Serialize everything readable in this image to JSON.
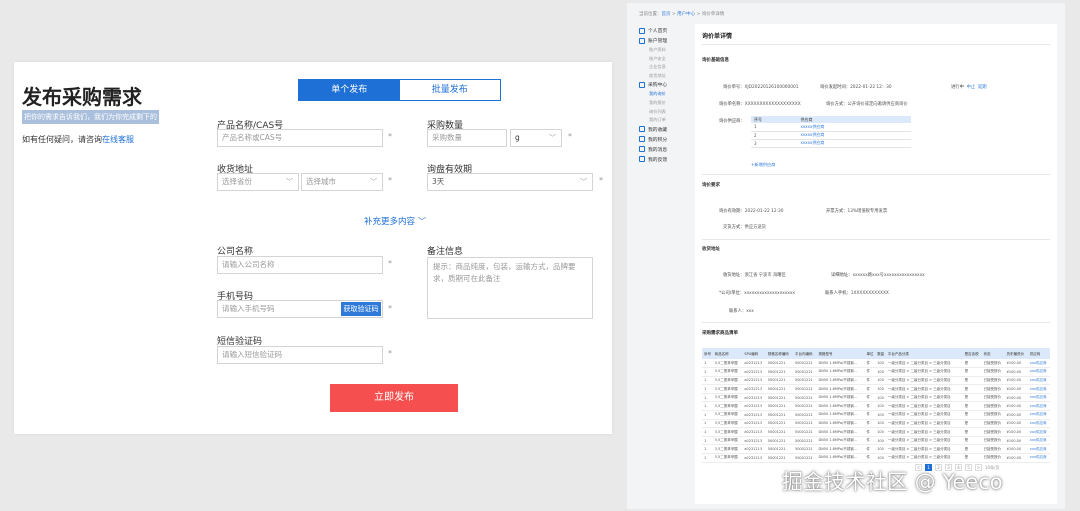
{
  "publish": {
    "title": "发布采购需求",
    "highlight": "把你的需求告诉我们，我们为你完成剩下的",
    "contact_text": "如有任何疑问，请咨询",
    "contact_link": "在线客服",
    "tabs": [
      "单个发布",
      "批量发布"
    ],
    "active_tab": "单个发布",
    "fields": {
      "product_label": "产品名称/CAS号",
      "product_placeholder": "产品名称或CAS号",
      "qty_label": "采购数量",
      "qty_placeholder": "采购数量",
      "unit_value": "g",
      "address_label": "收货地址",
      "province_placeholder": "选择省份",
      "city_placeholder": "选择城市",
      "validity_label": "询盘有效期",
      "validity_value": "3天",
      "more_link": "补充更多内容",
      "company_label": "公司名称",
      "company_placeholder": "请输入公司名称",
      "remark_label": "备注信息",
      "remark_placeholder": "提示：商品纯度，包装，运输方式，品牌要求，质期可在此备注",
      "phone_label": "手机号码",
      "phone_placeholder": "请输入手机号码",
      "get_code_button": "获取验证码",
      "code_label": "短信验证码",
      "code_placeholder": "请输入短信验证码",
      "required_mark": "*"
    },
    "submit": "立即发布"
  },
  "detail": {
    "breadcrumb": {
      "prefix": "当前位置：",
      "home": "首页",
      "sep": ">",
      "center": "用户中心",
      "current": "询价单详情"
    },
    "sidebar": [
      {
        "label": "个人首页",
        "icon": "home-icon",
        "subs": []
      },
      {
        "label": "账户管理",
        "icon": "account-icon",
        "subs": [
          "账户资料",
          "账户安全",
          "企业信息",
          "收货地址"
        ]
      },
      {
        "label": "采购中心",
        "icon": "cart-icon",
        "subs": [
          "我的询价",
          "我的报价",
          "询价列表",
          "我的订单"
        ]
      },
      {
        "label": "我的收藏",
        "icon": "heart-icon",
        "subs": []
      },
      {
        "label": "我的积分",
        "icon": "user-icon",
        "subs": []
      },
      {
        "label": "我的消息",
        "icon": "message-icon",
        "subs": []
      },
      {
        "label": "我的反馈",
        "icon": "feedback-icon",
        "subs": []
      }
    ],
    "title": "询价单详情",
    "basic": {
      "section": "询价基础信息",
      "order_no_label": "询价单号：",
      "order_no": "XJD20220126100000001",
      "time_label": "询价发起时间：",
      "time": "2022-01-22 12：30",
      "status_label": "进行中",
      "status_a": "中止",
      "status_b": "延期",
      "goods_label": "询价单名称：",
      "goods": "XXXXXXXXXXXXXXXXXXX",
      "method_label": "询价方式：",
      "method": "公开询价或定向邀请供应商询价",
      "supplier_label": "询价供应商：",
      "supplier_head": [
        "序号",
        "供应商"
      ],
      "suppliers": [
        [
          "1",
          "xxxxx供应商"
        ],
        [
          "2",
          "xxxxx供应商"
        ],
        [
          "3",
          "xxxxx供应商"
        ]
      ],
      "add_link": "+新增供应商"
    },
    "req": {
      "section": "询价要求",
      "deadline_label": "询价有效期：",
      "deadline": "2022-01-22 12:30",
      "invoice_label": "开票方式：",
      "invoice": "13%增值税专用发票",
      "pay_label": "交货方式：",
      "pay": "供应方送货"
    },
    "recv": {
      "section": "收货地址",
      "addr_label": "收货地址：",
      "addr": "浙江省 宁波市 海曙区",
      "detail_label": "详细地址：",
      "detail": "xxxxxx路xxx号xxxxxxxxxxxxxxxx",
      "company_label": "*公司/单位：",
      "company": "xxxxxxxxxxxxxxxxxxxx",
      "phone_label": "联系人手机：",
      "phone": "1XXXXXXXXXXXX",
      "contact_label": "联系人：",
      "contact": "xxx"
    },
    "list": {
      "section": "采购需求商品清单",
      "headers": [
        "序号",
        "商品名称",
        "SPU编码",
        "规格名称编码",
        "平台内编码",
        "规格型号",
        "单位",
        "数量",
        "平台产品分类",
        "是否含税",
        "状态",
        "历史最低价",
        "供应商"
      ],
      "rows": [
        [
          "1",
          "3,5二氯苯甲酸",
          "a0231213",
          "50001221",
          "50001221",
          "DN50 1.6MPa/不锈钢...",
          "件",
          "100",
          "一级分类目 > 二级分类目 > 三级分类目",
          "是",
          "已接受报价",
          "¥100.00",
          "xxx供应商"
        ],
        [
          "1",
          "3,5二氯苯甲酸",
          "a0231213",
          "50001221",
          "50001221",
          "DN50 1.6MPa/不锈钢...",
          "件",
          "100",
          "一级分类目 > 二级分类目 > 三级分类目",
          "是",
          "已接受报价",
          "¥100.00",
          "xxx供应商"
        ],
        [
          "1",
          "3,5二氯苯甲酸",
          "a0231213",
          "50001221",
          "50001221",
          "DN50 1.6MPa/不锈钢...",
          "件",
          "100",
          "一级分类目 > 二级分类目 > 三级分类目",
          "是",
          "已接受报价",
          "¥100.00",
          "xxx供应商"
        ],
        [
          "1",
          "3,5二氯苯甲酸",
          "a0231213",
          "50001221",
          "50001221",
          "DN50 1.6MPa/不锈钢...",
          "件",
          "100",
          "一级分类目 > 二级分类目 > 三级分类目",
          "是",
          "已接受报价",
          "¥100.00",
          "xxx供应商"
        ],
        [
          "1",
          "3,5二氯苯甲酸",
          "a0231213",
          "50001221",
          "50001221",
          "DN50 1.6MPa/不锈钢...",
          "件",
          "100",
          "一级分类目 > 二级分类目 > 三级分类目",
          "是",
          "已接受报价",
          "¥100.00",
          "xxx供应商"
        ],
        [
          "1",
          "3,5二氯苯甲酸",
          "a0231213",
          "50001221",
          "50001221",
          "DN50 1.6MPa/不锈钢...",
          "件",
          "100",
          "一级分类目 > 二级分类目 > 三级分类目",
          "是",
          "已接受报价",
          "¥100.00",
          "xxx供应商"
        ],
        [
          "1",
          "3,5二氯苯甲酸",
          "a0231213",
          "50001221",
          "50001221",
          "DN50 1.6MPa/不锈钢...",
          "件",
          "100",
          "一级分类目 > 二级分类目 > 三级分类目",
          "是",
          "已接受报价",
          "¥100.00",
          "xxx供应商"
        ],
        [
          "1",
          "3,5二氯苯甲酸",
          "a0231213",
          "50001221",
          "50001221",
          "DN50 1.6MPa/不锈钢...",
          "件",
          "100",
          "一级分类目 > 二级分类目 > 三级分类目",
          "是",
          "已接受报价",
          "¥100.00",
          "xxx供应商"
        ],
        [
          "1",
          "3,5二氯苯甲酸",
          "a0231213",
          "50001221",
          "50001221",
          "DN50 1.6MPa/不锈钢...",
          "件",
          "100",
          "一级分类目 > 二级分类目 > 三级分类目",
          "是",
          "已接受报价",
          "¥100.00",
          "xxx供应商"
        ],
        [
          "1",
          "3,5二氯苯甲酸",
          "a0231213",
          "50001221",
          "50001221",
          "DN50 1.6MPa/不锈钢...",
          "件",
          "100",
          "一级分类目 > 二级分类目 > 三级分类目",
          "是",
          "已接受报价",
          "¥100.00",
          "xxx供应商"
        ],
        [
          "1",
          "3,5二氯苯甲酸",
          "a0231213",
          "50001221",
          "50001221",
          "DN50 1.6MPa/不锈钢...",
          "件",
          "100",
          "一级分类目 > 二级分类目 > 三级分类目",
          "是",
          "已接受报价",
          "¥100.00",
          "xxx供应商"
        ],
        [
          "1",
          "3,5二氯苯甲酸",
          "a0231213",
          "50001221",
          "50001221",
          "DN50 1.6MPa/不锈钢...",
          "件",
          "100",
          "一级分类目 > 二级分类目 > 三级分类目",
          "是",
          "已接受报价",
          "¥100.00",
          "xxx供应商"
        ]
      ]
    },
    "pagination": {
      "prev": "<",
      "pages": [
        "1",
        "2",
        "3",
        "4",
        "5"
      ],
      "next": ">",
      "size": "10条/页"
    }
  },
  "watermark": "掘金技术社区 @ Yeeco"
}
